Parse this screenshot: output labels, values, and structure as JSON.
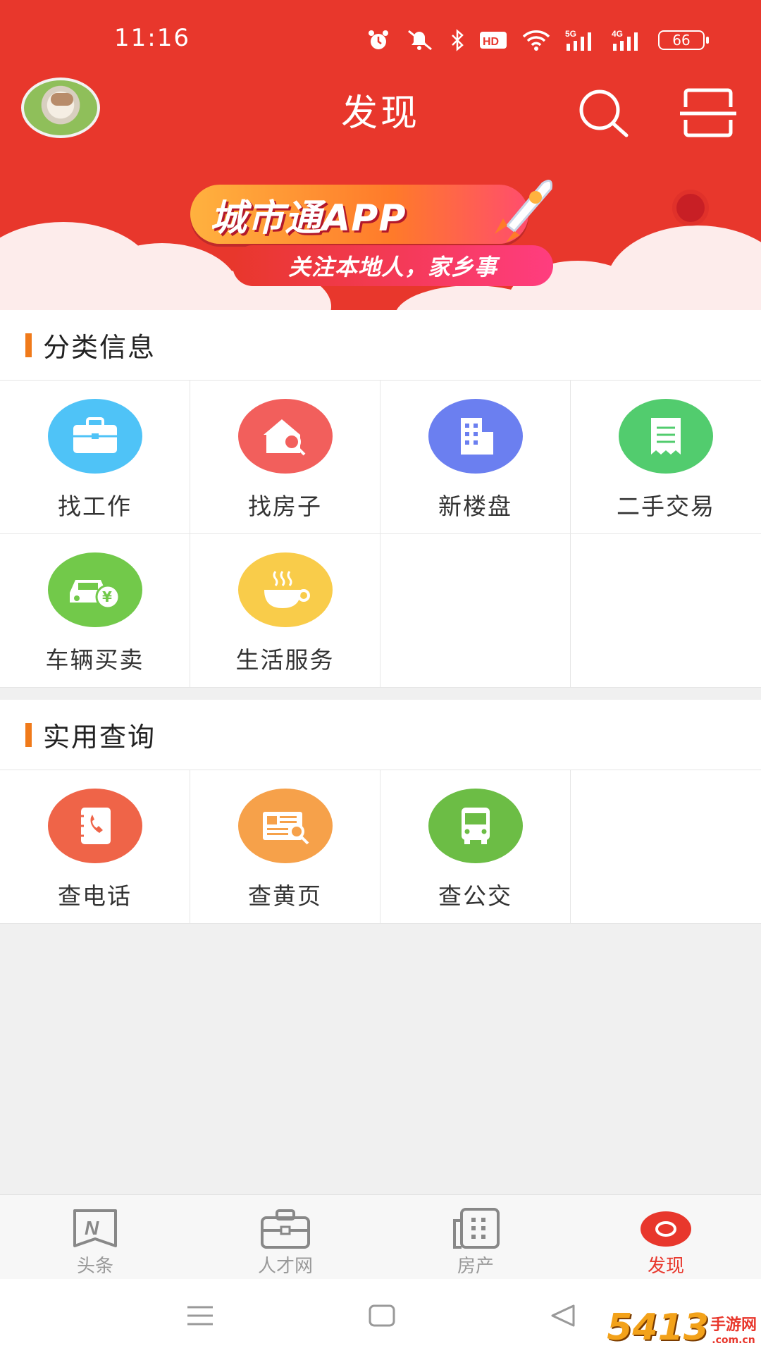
{
  "status": {
    "time": "11:16",
    "battery": "66",
    "net1": "5G",
    "net2": "4G"
  },
  "header": {
    "title": "发现"
  },
  "banner": {
    "title": "城市通APP",
    "subtitle": "关注本地人，家乡事"
  },
  "sections": [
    {
      "title": "分类信息",
      "items": [
        {
          "label": "找工作",
          "icon": "briefcase-icon",
          "color": "#4fc3f7"
        },
        {
          "label": "找房子",
          "icon": "house-search-icon",
          "color": "#f25f5c"
        },
        {
          "label": "新楼盘",
          "icon": "building-icon",
          "color": "#6b7ff0"
        },
        {
          "label": "二手交易",
          "icon": "receipt-icon",
          "color": "#52cc6e"
        },
        {
          "label": "车辆买卖",
          "icon": "car-yuan-icon",
          "color": "#72c94a"
        },
        {
          "label": "生活服务",
          "icon": "coffee-cup-icon",
          "color": "#f9cc4a"
        }
      ]
    },
    {
      "title": "实用查询",
      "items": [
        {
          "label": "查电话",
          "icon": "phone-book-icon",
          "color": "#ef6448"
        },
        {
          "label": "查黄页",
          "icon": "newspaper-search-icon",
          "color": "#f6a14a"
        },
        {
          "label": "查公交",
          "icon": "bus-icon",
          "color": "#6cbd45"
        }
      ]
    }
  ],
  "tabs": [
    {
      "label": "头条",
      "icon": "news-n-icon"
    },
    {
      "label": "人才网",
      "icon": "briefcase-tab-icon"
    },
    {
      "label": "房产",
      "icon": "building-tab-icon"
    },
    {
      "label": "发现",
      "icon": "eye-icon"
    }
  ],
  "colors": {
    "primary": "#e8372c",
    "accent_bar": "#f07a1a",
    "inactive": "#999999"
  },
  "watermark": {
    "number": "5413",
    "text": "手游网",
    "url": ".com.cn"
  }
}
